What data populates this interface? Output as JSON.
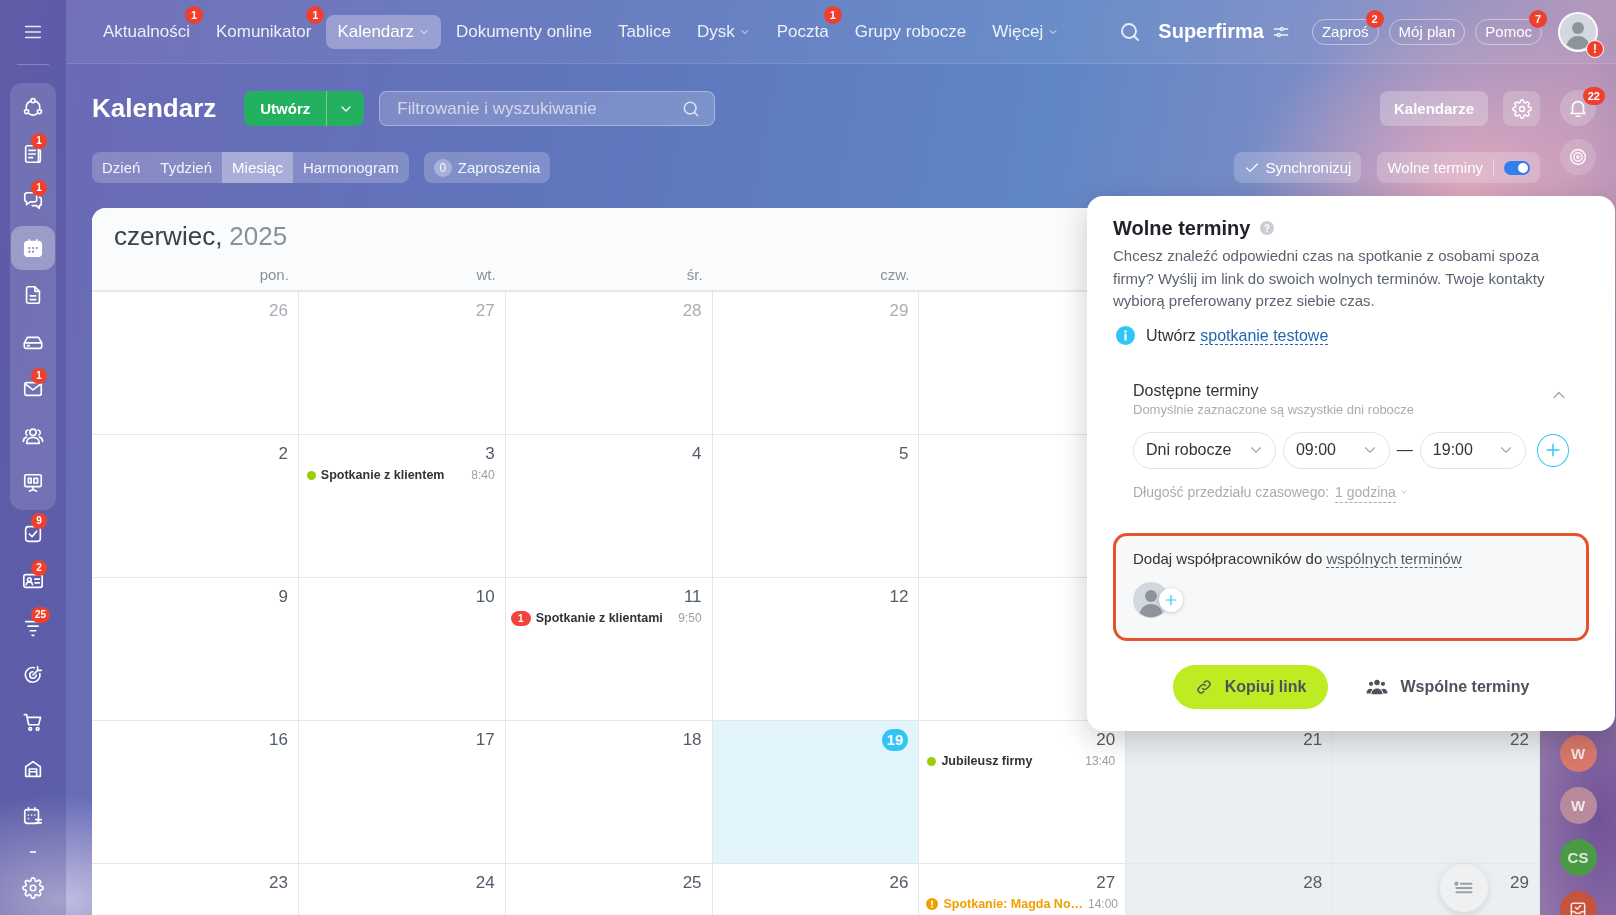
{
  "sidebar": {
    "pinned": [
      {
        "selected": false
      },
      {
        "selected": false,
        "badge": "1"
      },
      {
        "selected": false,
        "badge": "1"
      },
      {
        "selected": true
      },
      {
        "selected": false
      },
      {
        "selected": false
      },
      {
        "selected": false,
        "badge": "1"
      },
      {
        "selected": false
      },
      {
        "selected": false
      }
    ],
    "items": [
      {
        "selected": false,
        "badge": "9"
      },
      {
        "selected": false,
        "badge": "2"
      },
      {
        "selected": false,
        "badge": "25"
      },
      {
        "selected": false
      },
      {
        "selected": false
      },
      {
        "selected": false
      },
      {
        "selected": false
      },
      {
        "selected": false
      }
    ]
  },
  "top_nav": {
    "items": [
      {
        "label": "Aktualności",
        "badge": "1",
        "selected": false,
        "dropdown": false
      },
      {
        "label": "Komunikator",
        "badge": "1",
        "selected": false,
        "dropdown": false
      },
      {
        "label": "Kalendarz",
        "selected": true,
        "dropdown": true
      },
      {
        "label": "Dokumenty online",
        "selected": false,
        "dropdown": false
      },
      {
        "label": "Tablice",
        "selected": false,
        "dropdown": false
      },
      {
        "label": "Dysk",
        "selected": false,
        "dropdown": true
      },
      {
        "label": "Poczta",
        "badge": "1",
        "selected": false,
        "dropdown": false
      },
      {
        "label": "Grupy robocze",
        "selected": false,
        "dropdown": false
      },
      {
        "label": "Więcej",
        "selected": false,
        "dropdown": true
      }
    ],
    "company": "Superfirma",
    "pills": [
      {
        "label": "Zaproś",
        "badge": "2"
      },
      {
        "label": "Mój plan"
      },
      {
        "label": "Pomoc",
        "badge": "7"
      }
    ],
    "avatar_alert": "!"
  },
  "toolbar": {
    "title": "Kalendarz",
    "create_button": "Utwórz",
    "search": {
      "placeholder": "Filtrowanie i wyszukiwanie"
    },
    "calendars_button": "Kalendarze"
  },
  "view_tabs": [
    {
      "label": "Dzień",
      "selected": false
    },
    {
      "label": "Tydzień",
      "selected": false
    },
    {
      "label": "Miesiąc",
      "selected": true
    },
    {
      "label": "Harmonogram",
      "selected": false
    }
  ],
  "invitations": {
    "count": "0",
    "label": "Zaproszenia"
  },
  "sync_button": "Synchronizuj",
  "free_slots": {
    "label": "Wolne terminy",
    "on": true
  },
  "right_rail": {
    "notifications_badge": "22",
    "contacts": [
      {
        "initials": "W",
        "color": "#d9786d"
      },
      {
        "initials": "W",
        "color": "#b88a9c"
      },
      {
        "initials": "CS",
        "color": "#4a9a46"
      }
    ]
  },
  "calendar": {
    "month": "czerwiec,",
    "year": "2025",
    "weekdays": [
      "pon.",
      "wt.",
      "śr.",
      "czw."
    ],
    "weeks": [
      {
        "days": [
          {
            "day": "26",
            "other_month": true,
            "today": false,
            "weekend": false
          },
          {
            "day": "27",
            "other_month": true,
            "today": false,
            "weekend": false
          },
          {
            "day": "28",
            "other_month": true,
            "today": false,
            "weekend": false
          },
          {
            "day": "29",
            "other_month": true,
            "today": false,
            "weekend": false
          }
        ]
      },
      {
        "days": [
          {
            "day": "2",
            "other_month": false,
            "today": false,
            "weekend": false
          },
          {
            "day": "3",
            "other_month": false,
            "today": false,
            "weekend": false,
            "events": [
              {
                "kind": "dot",
                "color": "#9dcf00",
                "title": "Spotkanie z klientem",
                "time": "8:40"
              }
            ]
          },
          {
            "day": "4",
            "other_month": false,
            "today": false,
            "weekend": false
          },
          {
            "day": "5",
            "other_month": false,
            "today": false,
            "weekend": false
          }
        ]
      },
      {
        "days": [
          {
            "day": "9",
            "other_month": false,
            "today": false,
            "weekend": false
          },
          {
            "day": "10",
            "other_month": false,
            "today": false,
            "weekend": false
          },
          {
            "day": "11",
            "other_month": false,
            "today": false,
            "weekend": false,
            "events": [
              {
                "kind": "count",
                "color": "#f4433c",
                "count": "1",
                "title": "Spotkanie z klientami",
                "time": "9:50"
              }
            ]
          },
          {
            "day": "12",
            "other_month": false,
            "today": false,
            "weekend": false
          }
        ]
      },
      {
        "days": [
          {
            "day": "16",
            "other_month": false,
            "today": false,
            "weekend": false
          },
          {
            "day": "17",
            "other_month": false,
            "today": false,
            "weekend": false
          },
          {
            "day": "18",
            "other_month": false,
            "today": false,
            "weekend": false
          },
          {
            "day": "19",
            "other_month": false,
            "today": true,
            "weekend": false
          },
          {
            "day": "20",
            "other_month": false,
            "today": false,
            "weekend": false,
            "events": [
              {
                "kind": "dot",
                "color": "#9dcf00",
                "title": "Jubileusz firmy",
                "time": "13:40"
              }
            ]
          },
          {
            "day": "21",
            "other_month": false,
            "today": false,
            "weekend": true
          },
          {
            "day": "22",
            "other_month": false,
            "today": false,
            "weekend": true
          }
        ]
      },
      {
        "days": [
          {
            "day": "23",
            "other_month": false,
            "today": false,
            "weekend": false
          },
          {
            "day": "24",
            "other_month": false,
            "today": false,
            "weekend": false
          },
          {
            "day": "25",
            "other_month": false,
            "today": false,
            "weekend": false
          },
          {
            "day": "26",
            "other_month": false,
            "today": false,
            "weekend": false
          },
          {
            "day": "27",
            "other_month": false,
            "today": false,
            "weekend": false,
            "events": [
              {
                "kind": "alert",
                "color": "#f0a100",
                "title": "Spotkanie: Magda No…",
                "time": "14:00"
              }
            ]
          },
          {
            "day": "28",
            "other_month": false,
            "today": false,
            "weekend": true
          },
          {
            "day": "29",
            "other_month": false,
            "today": false,
            "weekend": true
          }
        ]
      }
    ]
  },
  "popup": {
    "title": "Wolne terminy",
    "description": "Chcesz znaleźć odpowiedni czas na spotkanie z osobami spoza firmy? Wyślij im link do swoich wolnych terminów. Twoje kontakty wybiorą preferowany przez siebie czas.",
    "test_meeting": {
      "text": "Utwórz",
      "link": "spotkanie testowe"
    },
    "availability": {
      "title": "Dostępne terminy",
      "subtitle": "Domyślnie zaznaczone są wszystkie dni robocze",
      "expanded": true,
      "days": "Dni robocze",
      "from": "09:00",
      "separator": "—",
      "to": "19:00"
    },
    "slot_length": {
      "label": "Długość przedziału czasowego:",
      "value": "1 godzina"
    },
    "colleagues": {
      "text": "Dodaj współpracowników do",
      "link": "wspólnych terminów",
      "highlighted": true
    },
    "copy_button": "Kopiuj link",
    "shared_button": "Wspólne terminy"
  }
}
